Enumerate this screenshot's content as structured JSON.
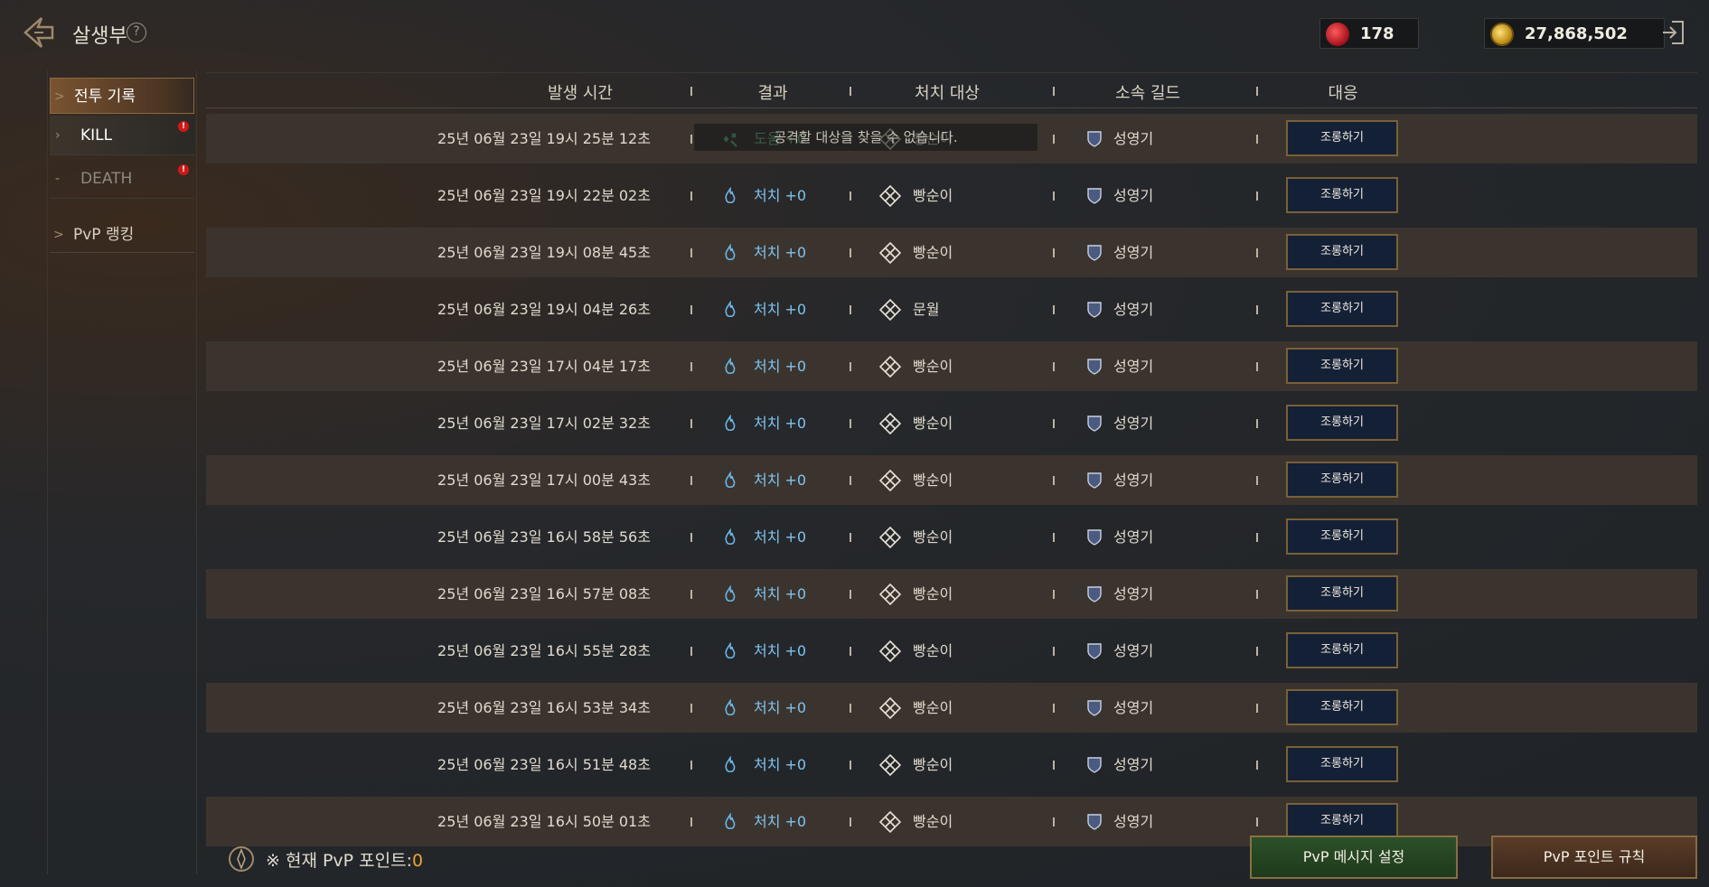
{
  "header": {
    "title": "살생부",
    "help_symbol": "?"
  },
  "currency": {
    "ruby": "178",
    "gold": "27,868,502"
  },
  "sidebar": {
    "items": [
      {
        "label": "전투 기록",
        "active": true
      },
      {
        "label": "KILL",
        "active": true,
        "alert": "!"
      },
      {
        "label": "DEATH",
        "active": false,
        "alert": "!"
      },
      {
        "label": "PvP 랭킹",
        "active": false
      }
    ]
  },
  "table": {
    "columns": [
      "발생 시간",
      "결과",
      "처치 대상",
      "소속 길드",
      "대응"
    ],
    "rows": [
      {
        "time": "25년 06월 23일 19시 25분 12초",
        "result": "도움 +0",
        "type": "assist",
        "target": "빵순이",
        "guild": "성영기",
        "action": "조롱하기"
      },
      {
        "time": "25년 06월 23일 19시 22분 02초",
        "result": "처치 +0",
        "type": "kill",
        "target": "빵순이",
        "guild": "성영기",
        "action": "조롱하기"
      },
      {
        "time": "25년 06월 23일 19시 08분 45초",
        "result": "처치 +0",
        "type": "kill",
        "target": "빵순이",
        "guild": "성영기",
        "action": "조롱하기"
      },
      {
        "time": "25년 06월 23일 19시 04분 26초",
        "result": "처치 +0",
        "type": "kill",
        "target": "문월",
        "guild": "성영기",
        "action": "조롱하기"
      },
      {
        "time": "25년 06월 23일 17시 04분 17초",
        "result": "처치 +0",
        "type": "kill",
        "target": "빵순이",
        "guild": "성영기",
        "action": "조롱하기"
      },
      {
        "time": "25년 06월 23일 17시 02분 32초",
        "result": "처치 +0",
        "type": "kill",
        "target": "빵순이",
        "guild": "성영기",
        "action": "조롱하기"
      },
      {
        "time": "25년 06월 23일 17시 00분 43초",
        "result": "처치 +0",
        "type": "kill",
        "target": "빵순이",
        "guild": "성영기",
        "action": "조롱하기"
      },
      {
        "time": "25년 06월 23일 16시 58분 56초",
        "result": "처치 +0",
        "type": "kill",
        "target": "빵순이",
        "guild": "성영기",
        "action": "조롱하기"
      },
      {
        "time": "25년 06월 23일 16시 57분 08초",
        "result": "처치 +0",
        "type": "kill",
        "target": "빵순이",
        "guild": "성영기",
        "action": "조롱하기"
      },
      {
        "time": "25년 06월 23일 16시 55분 28초",
        "result": "처치 +0",
        "type": "kill",
        "target": "빵순이",
        "guild": "성영기",
        "action": "조롱하기"
      },
      {
        "time": "25년 06월 23일 16시 53분 34초",
        "result": "처치 +0",
        "type": "kill",
        "target": "빵순이",
        "guild": "성영기",
        "action": "조롱하기"
      },
      {
        "time": "25년 06월 23일 16시 51분 48초",
        "result": "처치 +0",
        "type": "kill",
        "target": "빵순이",
        "guild": "성영기",
        "action": "조롱하기"
      },
      {
        "time": "25년 06월 23일 16시 50분 01초",
        "result": "처치 +0",
        "type": "kill",
        "target": "빵순이",
        "guild": "성영기",
        "action": "조롱하기"
      }
    ]
  },
  "toast": "공격할 대상을 찾을 수 없습니다.",
  "footer": {
    "pvp_label": "※ 현재 PvP 포인트:",
    "pvp_value": "0",
    "message_button": "PvP 메시지 설정",
    "rule_button": "PvP 포인트 규칙"
  },
  "colors": {
    "kill_text": "#7fc4f0",
    "assist_text": "#6edb9a",
    "accent": "#f0a030",
    "taunt_bg": "#142036"
  },
  "icons": {
    "back": "back-arrow-icon",
    "help": "help-icon",
    "ruby": "ruby-icon",
    "gold": "gold-coin-icon",
    "exit": "exit-icon",
    "kill": "flame-icon",
    "assist": "assist-icon",
    "target": "class-emblem-icon",
    "guild": "guild-crest-icon",
    "pvp": "pvp-emblem-icon"
  }
}
